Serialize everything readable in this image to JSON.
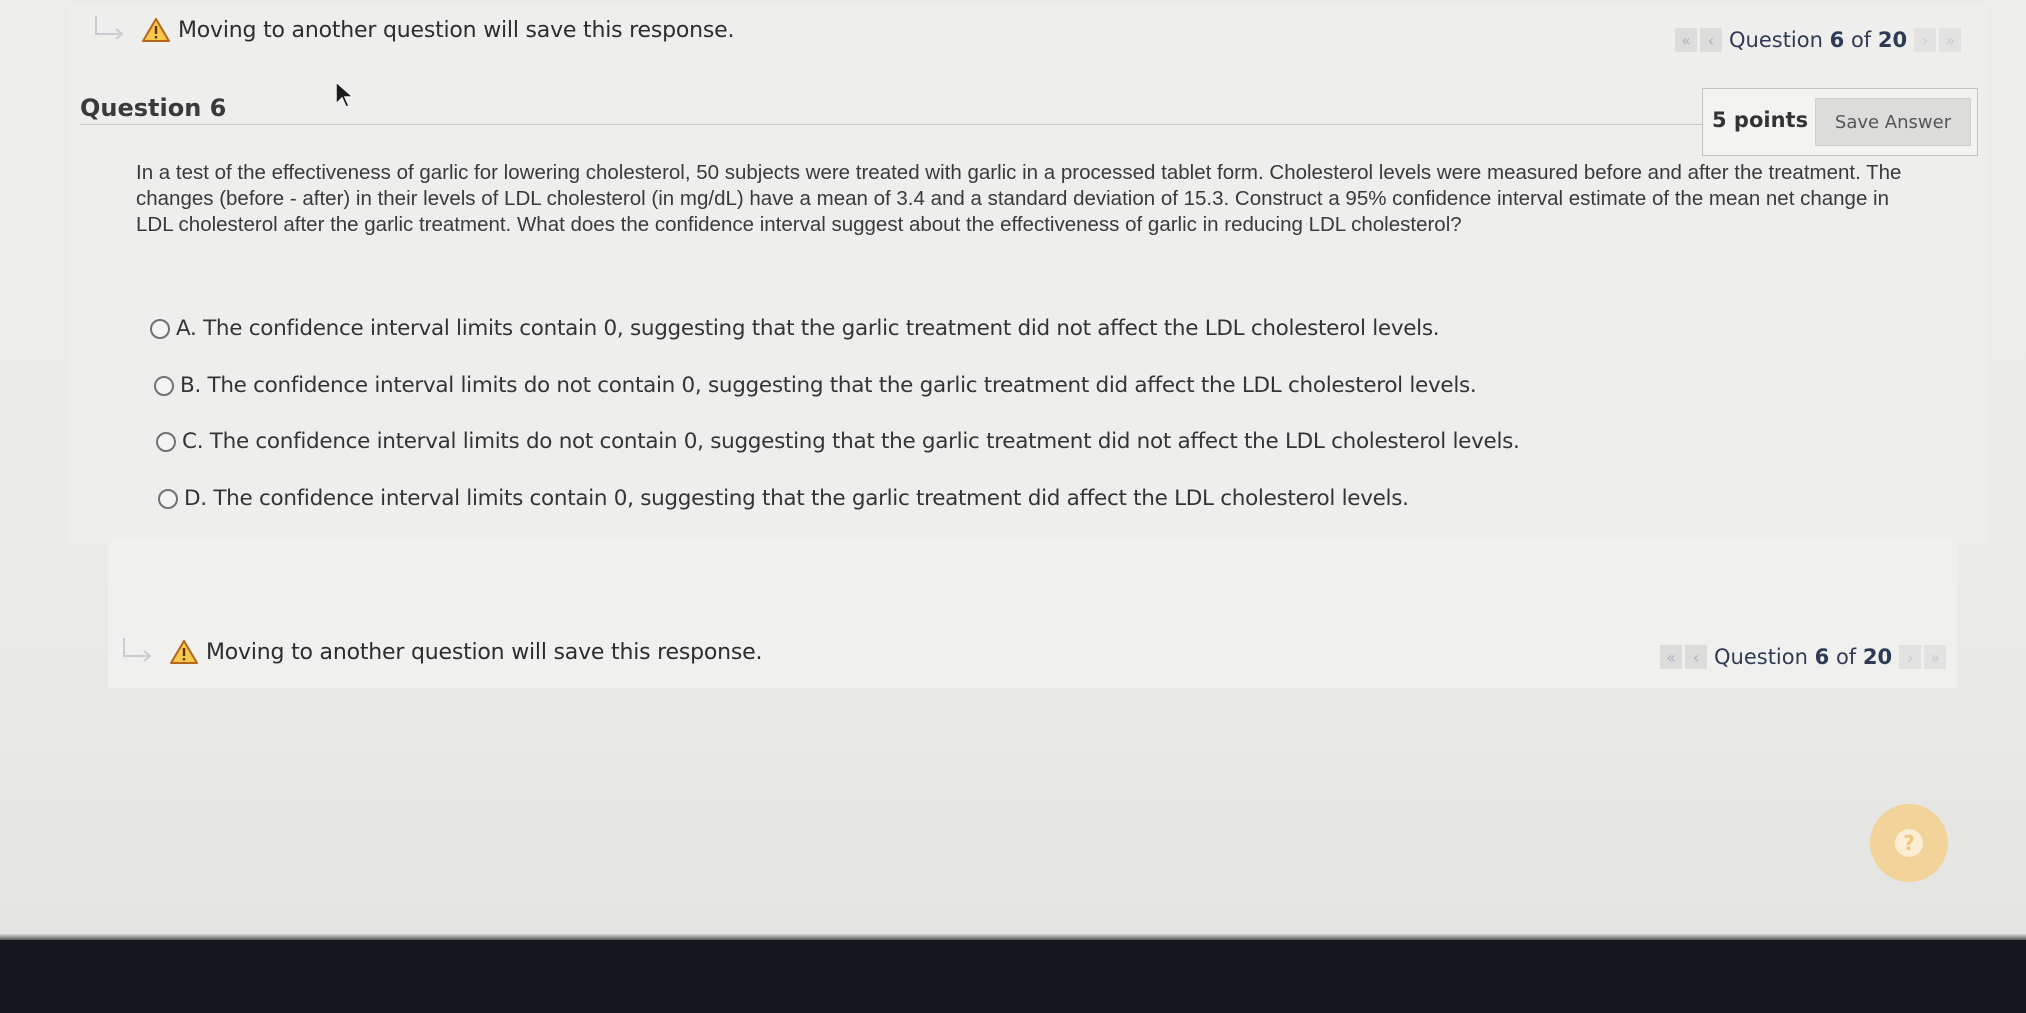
{
  "warning": {
    "icon": "warning-triangle-icon",
    "text": "Moving to another question will save this response."
  },
  "pager": {
    "first_icon": "«",
    "prev_icon": "‹",
    "next_icon": "›",
    "last_icon": "»",
    "label_prefix": "Question",
    "current": "6",
    "of": "of",
    "total": "20"
  },
  "question": {
    "title": "Question 6",
    "points": "5 points",
    "save_label": "Save Answer",
    "text": "In a test of the effectiveness of garlic for lowering cholesterol, 50 subjects were treated with garlic in a processed tablet form. Cholesterol levels were measured before and after the treatment. The changes (before - after) in their levels of LDL cholesterol (in mg/dL) have a mean of 3.4 and a standard deviation of 15.3. Construct a 95% confidence interval estimate of the mean net change in LDL cholesterol after the garlic treatment. What does the confidence interval suggest about the effectiveness of garlic in reducing LDL cholesterol?",
    "options": [
      {
        "label": "A. The confidence interval limits contain 0, suggesting that the garlic treatment did not affect the LDL cholesterol levels."
      },
      {
        "label": "B. The confidence interval limits do not contain 0, suggesting that the garlic treatment did affect the LDL cholesterol levels."
      },
      {
        "label": "C. The confidence interval limits do not contain 0, suggesting that the garlic treatment did not affect the LDL cholesterol levels."
      },
      {
        "label": "D. The confidence interval limits contain 0, suggesting that the garlic treatment did affect the LDL cholesterol levels."
      }
    ]
  },
  "help": {
    "label": "?",
    "color": "#f2d49a"
  },
  "colors": {
    "accent_pager": "#2f3b55",
    "warning": "#e8a21a"
  }
}
